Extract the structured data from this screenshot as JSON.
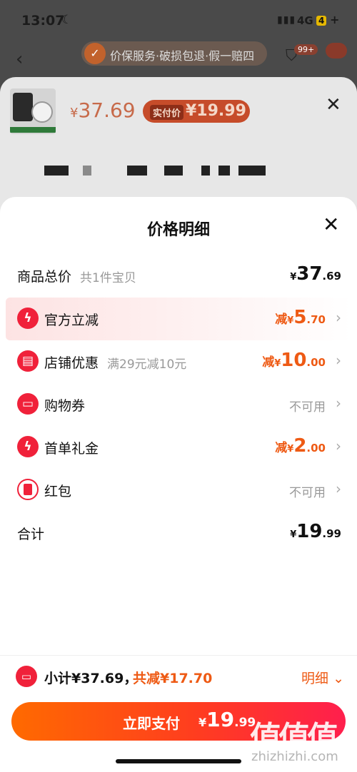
{
  "status_bar": {
    "time": "13:07",
    "network": "4G",
    "badge": "4"
  },
  "background": {
    "guarantee_text": "价保服务·破损包退·假一赔四",
    "cart_badge": "99+",
    "product_price_yen": "¥",
    "product_price": "37.69",
    "actual_label": "实付价",
    "actual_price": "¥19.99"
  },
  "sheet": {
    "title": "价格明细",
    "rows": [
      {
        "label": "商品总价",
        "sub": "共1件宝贝",
        "yen": "¥",
        "int": "37",
        "dec": ".69"
      },
      {
        "label": "官方立减",
        "prefix": "减",
        "yen": "¥",
        "int": "5",
        "dec": ".70",
        "icon": "lightning-icon"
      },
      {
        "label": "店铺优惠",
        "sub": "满29元减10元",
        "prefix": "减",
        "yen": "¥",
        "int": "10",
        "dec": ".00",
        "icon": "shop-icon"
      },
      {
        "label": "购物券",
        "value": "不可用",
        "icon": "ticket-icon"
      },
      {
        "label": "首单礼金",
        "prefix": "减",
        "yen": "¥",
        "int": "2",
        "dec": ".00",
        "icon": "lightning-icon"
      },
      {
        "label": "红包",
        "value": "不可用",
        "icon": "red-envelope-icon"
      },
      {
        "label": "合计",
        "yen": "¥",
        "int": "19",
        "dec": ".99"
      }
    ]
  },
  "bottom": {
    "subtotal": "小计¥37.69，",
    "discount": "共减¥17.70",
    "detail_link": "明细",
    "pay_label": "立即支付",
    "pay_yen": "¥",
    "pay_int": "19",
    "pay_dec": ".99"
  },
  "watermark": {
    "text": "值值值",
    "url": "zhizhizhi.com"
  },
  "colors": {
    "accent": "#ee5a14",
    "brand_red": "#f0213a"
  }
}
